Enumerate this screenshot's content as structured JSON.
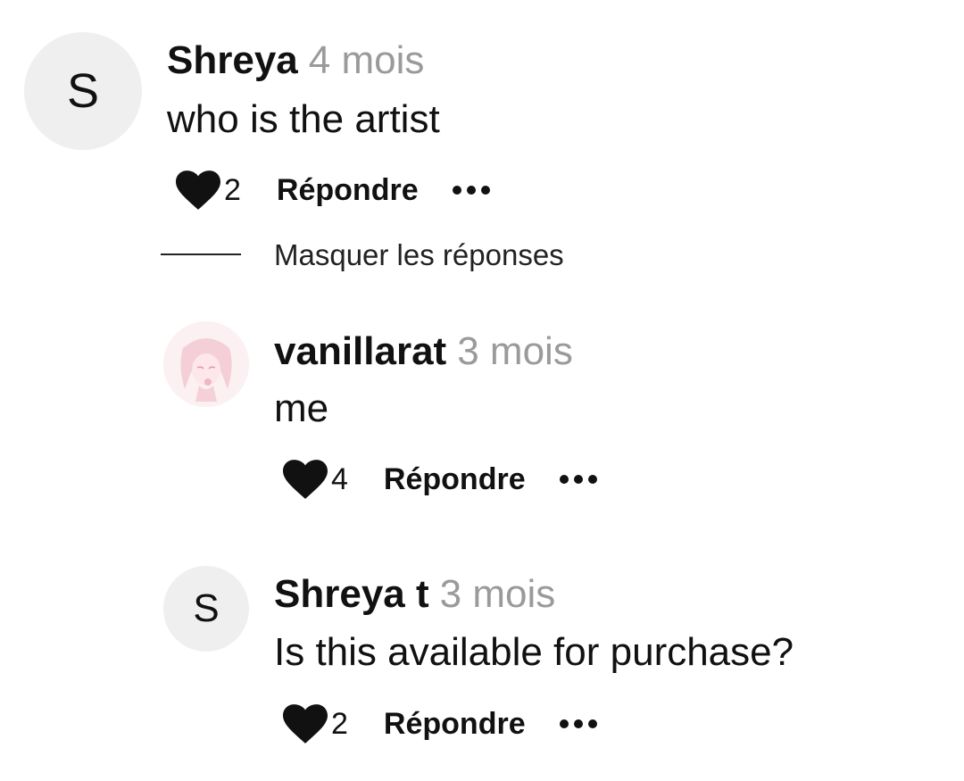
{
  "comments": [
    {
      "author": "Shreya",
      "time": "4 mois",
      "text": "who is the artist",
      "avatar_letter": "S",
      "likes": "2",
      "reply_label": "Répondre"
    }
  ],
  "hide_replies_label": "Masquer les réponses",
  "replies": [
    {
      "author": "vanillarat",
      "time": "3 mois",
      "text": "me",
      "avatar_type": "image",
      "likes": "4",
      "reply_label": "Répondre"
    },
    {
      "author": "Shreya t",
      "time": "3 mois",
      "text": "Is this available for purchase?",
      "avatar_letter": "S",
      "likes": "2",
      "reply_label": "Répondre"
    }
  ],
  "icons": {
    "like": "heart-icon",
    "more": "more-options-icon"
  },
  "colors": {
    "text": "#111111",
    "timestamp": "#9a9a9a",
    "avatar_bg": "#efefef"
  }
}
